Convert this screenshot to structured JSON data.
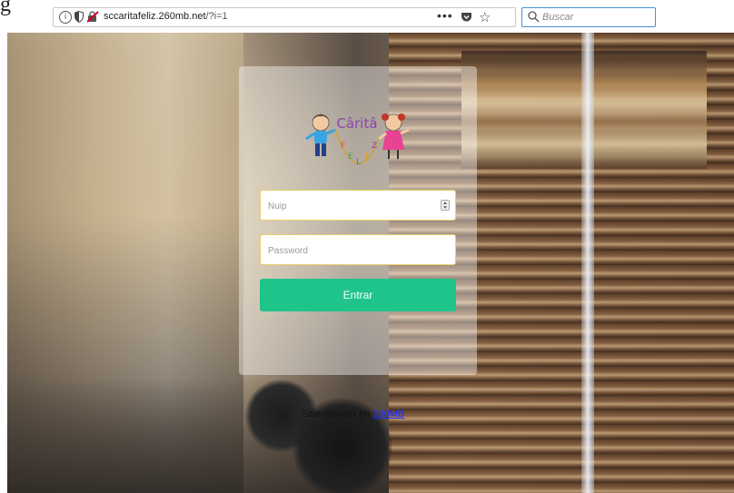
{
  "browser": {
    "url_domain": "sccaritafeliz.260mb.net",
    "url_path": "/?i=1",
    "more_label": "•••",
    "star_label": "☆",
    "search_placeholder": "Buscar",
    "partial_char": "g"
  },
  "logo": {
    "title": "Câritâ",
    "letters": [
      "F",
      "E",
      "L",
      "I",
      "Z"
    ]
  },
  "login": {
    "nuip_placeholder": "Nuip",
    "password_placeholder": "Password",
    "submit_label": "Entrar"
  },
  "footer": {
    "prefix": "Sitio alojado en ",
    "link_label": "260MB"
  },
  "colors": {
    "submit": "#1fc48a",
    "field_border": "#e8cf6a",
    "link": "#1a2bff"
  }
}
